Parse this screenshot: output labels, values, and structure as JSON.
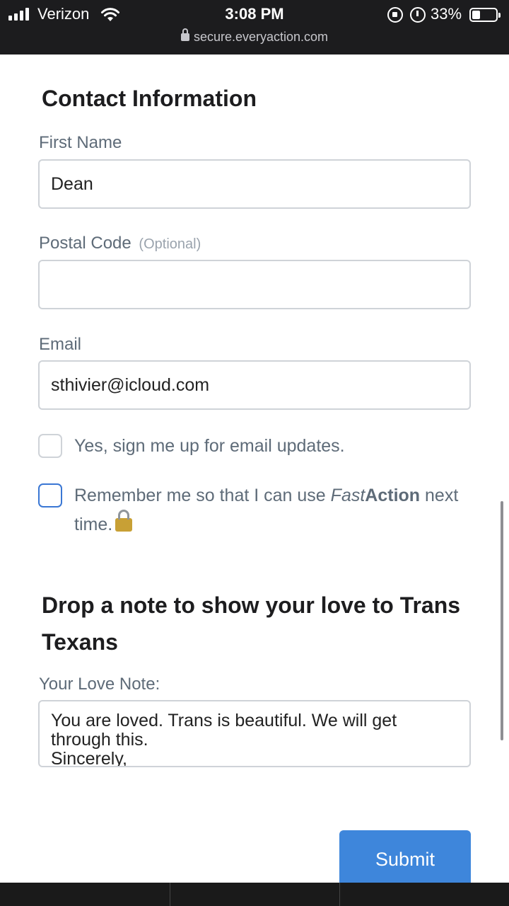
{
  "status_bar": {
    "carrier": "Verizon",
    "time": "3:08 PM",
    "battery_percent": "33%",
    "battery_level": 0.33,
    "url": "secure.everyaction.com",
    "icons": [
      "signal-icon",
      "wifi-icon",
      "rotation-lock-icon",
      "alarm-icon",
      "battery-icon",
      "padlock-icon"
    ]
  },
  "contact": {
    "heading": "Contact Information",
    "first_name": {
      "label": "First Name",
      "value": "Dean"
    },
    "postal_code": {
      "label": "Postal Code",
      "optional": "(Optional)",
      "value": ""
    },
    "email": {
      "label": "Email",
      "value": "sthivier@icloud.com"
    },
    "signup": {
      "label": "Yes, sign me up for email updates.",
      "checked": false
    },
    "remember": {
      "text_before": "Remember me so that I can use ",
      "fast": "Fast",
      "action": "Action",
      "text_after": " next time.",
      "checked": false
    }
  },
  "note": {
    "heading": "Drop a note to show your love to Trans Texans",
    "label": "Your Love Note:",
    "value": "You are loved. Trans is beautiful. We will get through this.\nSincerely,"
  },
  "submit_label": "Submit",
  "colors": {
    "accent": "#3e86db",
    "status_bar_bg": "#1c1c1e",
    "label_text": "#5e6b78",
    "input_border": "#cfd3d8"
  }
}
